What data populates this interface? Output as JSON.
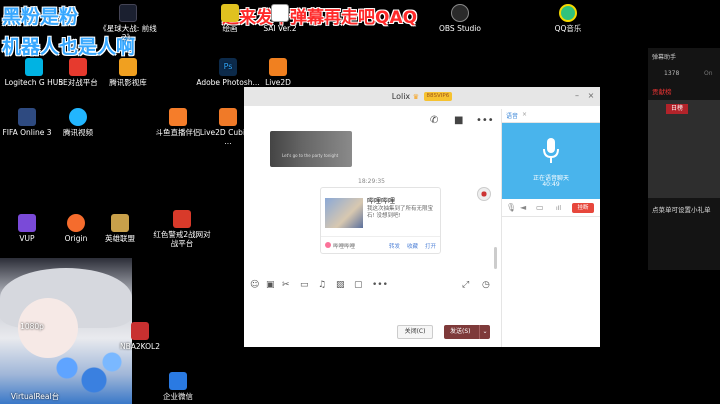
{
  "overlay": {
    "line1": "黑粉是粉",
    "line2": "机器人也是人啊",
    "danmaku": "进来发个弹幕再走吧QAQ"
  },
  "icons": [
    {
      "label": "《星球大战: 前线2》",
      "color": "#1b2030"
    },
    {
      "label": "绘画",
      "color": "#e0c120"
    },
    {
      "label": "SAI Ver.2",
      "color": "#ffffff"
    },
    {
      "label": "OBS Studio",
      "color": "#2a2a2a"
    },
    {
      "label": "QQ音乐",
      "color": "#31c27c"
    },
    {
      "label": "Logitech G HUB",
      "color": "#00b3e3"
    },
    {
      "label": "5E对战平台",
      "color": "#e63a2e"
    },
    {
      "label": "腾讯影视库",
      "color": "#f0a020"
    },
    {
      "label": "Adobe Photosh...",
      "color": "#0c2a4a"
    },
    {
      "label": "Live2D",
      "color": "#f08020"
    },
    {
      "label": "FIFA Online 3",
      "color": "#2e4a80"
    },
    {
      "label": "腾讯视频",
      "color": "#22b6ff"
    },
    {
      "label": "斗鱼直播伴侣",
      "color": "#f57d2a"
    },
    {
      "label": "Live2D Cubism ...",
      "color": "#f07a28"
    },
    {
      "label": "VUP",
      "color": "#7a4ad8"
    },
    {
      "label": "Origin",
      "color": "#f56c2d"
    },
    {
      "label": "英雄联盟",
      "color": "#c8a04a"
    },
    {
      "label": "红色警戒2战网对战平台",
      "color": "#d83a2a"
    },
    {
      "label": "NBA2KOL2",
      "color": "#c83030"
    },
    {
      "label": "企业微信",
      "color": "#2a7ae2"
    },
    {
      "label": "1080p",
      "color": "#333333"
    },
    {
      "label": "VirtualReal台",
      "color": "#333333"
    }
  ],
  "right_panel": {
    "name": "弹幕助手",
    "count": "1378",
    "status": "On",
    "title": "贡献榜",
    "tab": "日榜",
    "notice": "点菜单可设置小礼单"
  },
  "qq": {
    "contact": "Lolix",
    "badge": "88SVIP6",
    "timestamp": "18:29:35",
    "image_caption": "Let's go to the party tonight",
    "card": {
      "title": "哔哩哔哩",
      "desc": "我这次抽集到了所有无限宝石! 没想到吧!",
      "source": "哔哩哔哩",
      "actions": [
        "转发",
        "收藏",
        "打开"
      ]
    },
    "close_label": "关闭(C)",
    "send_label": "发送(S)",
    "voice": {
      "tab_label": "语音",
      "status": "正在语音聊天",
      "time": "40:49",
      "hangup": "挂断"
    }
  }
}
